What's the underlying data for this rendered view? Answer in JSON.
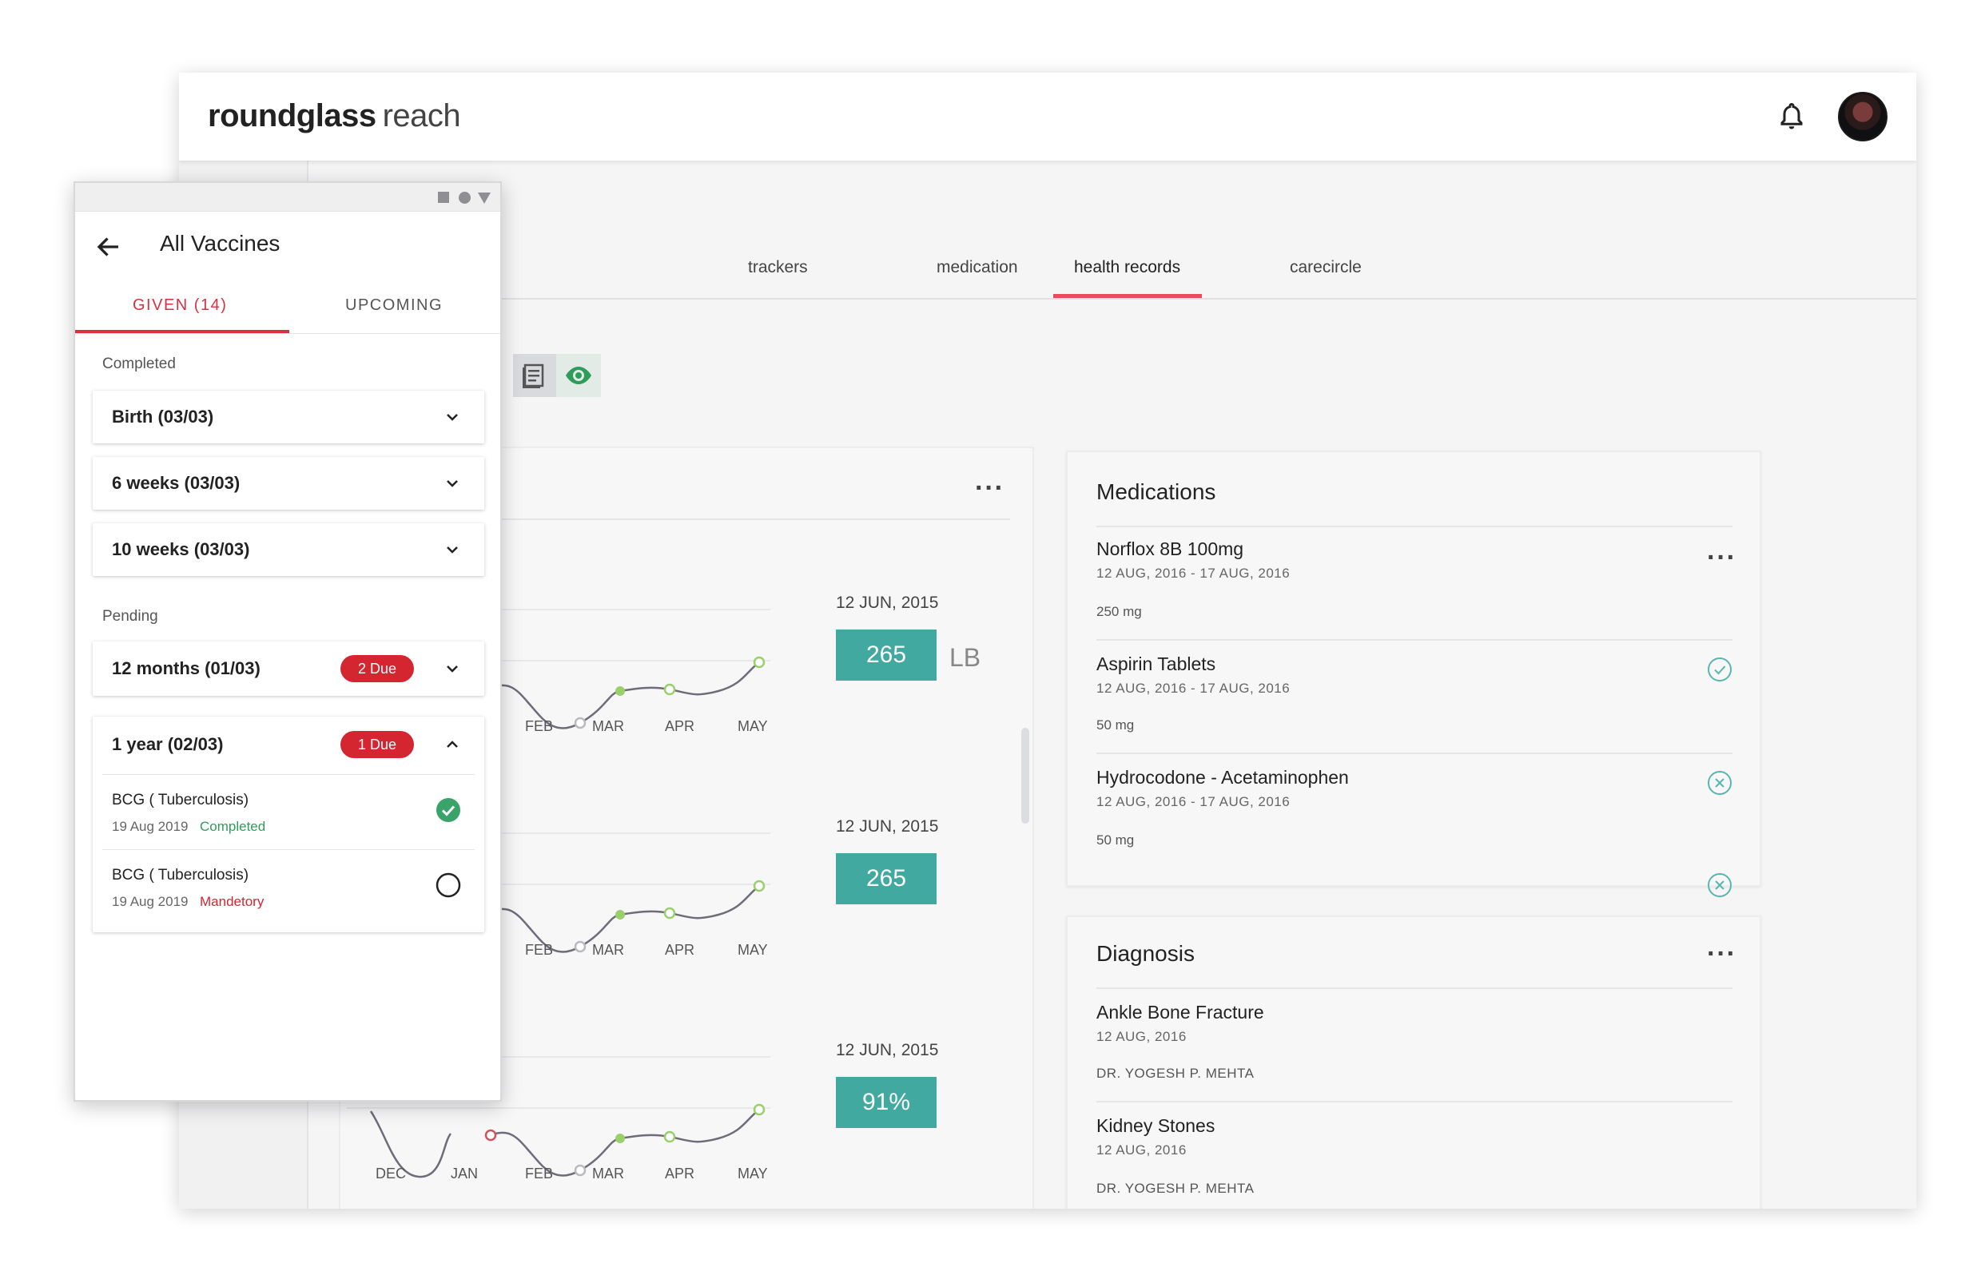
{
  "app": {
    "logo_bold": "roundglass",
    "logo_regular": "reach",
    "bell_icon": "bell-icon",
    "avatar_icon": "user-avatar"
  },
  "tabs": [
    {
      "label": "trackers"
    },
    {
      "label": "medication"
    },
    {
      "label": "health records"
    },
    {
      "label": "carecircle"
    }
  ],
  "active_tab": "health records",
  "colors": {
    "accent_red": "#e94b5a",
    "teal": "#42a9a0",
    "green": "#2e9d5b",
    "badge_red": "#d32631"
  },
  "trackers": {
    "months": [
      "DEC",
      "JAN",
      "FEB",
      "MAR",
      "APR",
      "MAY"
    ],
    "items": [
      {
        "date": "12 JUN, 2015",
        "value": "265",
        "unit": "LB"
      },
      {
        "date": "12 JUN, 2015",
        "value": "265",
        "unit": ""
      },
      {
        "date": "12 JUN, 2015",
        "value": "91%",
        "unit": ""
      }
    ]
  },
  "medications": {
    "title": "Medications",
    "items": [
      {
        "name": "Norflox 8B 100mg",
        "dates": "12 AUG, 2016 - 17 AUG, 2016",
        "dose": "250 mg",
        "status": "more"
      },
      {
        "name": "Aspirin Tablets",
        "dates": "12 AUG, 2016 - 17 AUG, 2016",
        "dose": "50 mg",
        "status": "taken"
      },
      {
        "name": "Hydrocodone - Acetaminophen",
        "dates": "12 AUG, 2016 - 17 AUG, 2016",
        "dose": "50 mg",
        "status": "missed"
      }
    ]
  },
  "diagnosis": {
    "title": "Diagnosis",
    "items": [
      {
        "name": "Ankle Bone Fracture",
        "date": "12 AUG, 2016",
        "doctor": "DR. YOGESH P. MEHTA"
      },
      {
        "name": "Kidney Stones",
        "date": "12 AUG, 2016",
        "doctor": "DR. YOGESH P. MEHTA"
      }
    ]
  },
  "vaccines": {
    "title": "All Vaccines",
    "tab_given": "GIVEN (14)",
    "tab_upcoming": "UPCOMING",
    "completed_label": "Completed",
    "pending_label": "Pending",
    "completed": [
      {
        "label": "Birth (03/03)"
      },
      {
        "label": "6 weeks (03/03)"
      },
      {
        "label": "10 weeks (03/03)"
      }
    ],
    "pending": [
      {
        "label": "12 months (01/03)",
        "badge": "2 Due"
      },
      {
        "label": "1 year (02/03)",
        "badge": "1 Due"
      }
    ],
    "expanded_items": [
      {
        "name": "BCG ( Tuberculosis)",
        "date": "19 Aug 2019",
        "status": "Completed",
        "status_color": "#2e9d5b"
      },
      {
        "name": "BCG ( Tuberculosis)",
        "date": "19 Aug 2019",
        "status": "Mandetory",
        "status_color": "#d32631"
      }
    ]
  }
}
